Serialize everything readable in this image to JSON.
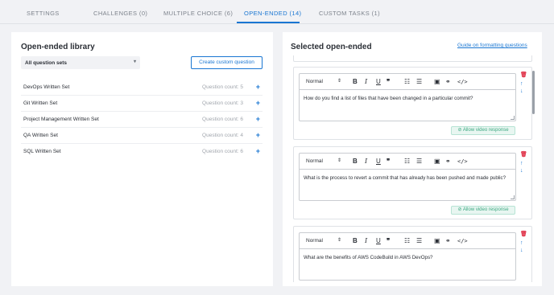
{
  "tabs": [
    {
      "label": "SETTINGS",
      "active": false
    },
    {
      "label": "CHALLENGES (0)",
      "active": false
    },
    {
      "label": "MULTIPLE CHOICE (6)",
      "active": false
    },
    {
      "label": "OPEN-ENDED (14)",
      "active": true
    },
    {
      "label": "CUSTOM TASKS (1)",
      "active": false
    }
  ],
  "library": {
    "title": "Open-ended library",
    "filter_value": "All question sets",
    "create_button": "Create custom question",
    "sets": [
      {
        "name": "DevOps Written Set",
        "count": "Question count: 5"
      },
      {
        "name": "Git Written Set",
        "count": "Question count: 3"
      },
      {
        "name": "Project Management Written Set",
        "count": "Question count: 6"
      },
      {
        "name": "QA Written Set",
        "count": "Question count: 4"
      },
      {
        "name": "SQL Written Set",
        "count": "Question count: 6"
      }
    ]
  },
  "selected": {
    "title": "Selected open-ended",
    "guide_link": "Guide on formatting questions",
    "toolbar_format": "Normal",
    "video_button": "Allow video response",
    "questions": [
      {
        "text": "How do you find a list of files that have been changed in a particular commit?",
        "show_video": true
      },
      {
        "text": "What is the process to revert a commit that has already has been pushed and made public?",
        "show_video": true
      },
      {
        "text": "What are the benefits of AWS CodeBuild in AWS DevOps?",
        "show_video": false
      }
    ]
  },
  "colors": {
    "accent": "#1976d2",
    "danger": "#e0344a",
    "success": "#3da882"
  }
}
